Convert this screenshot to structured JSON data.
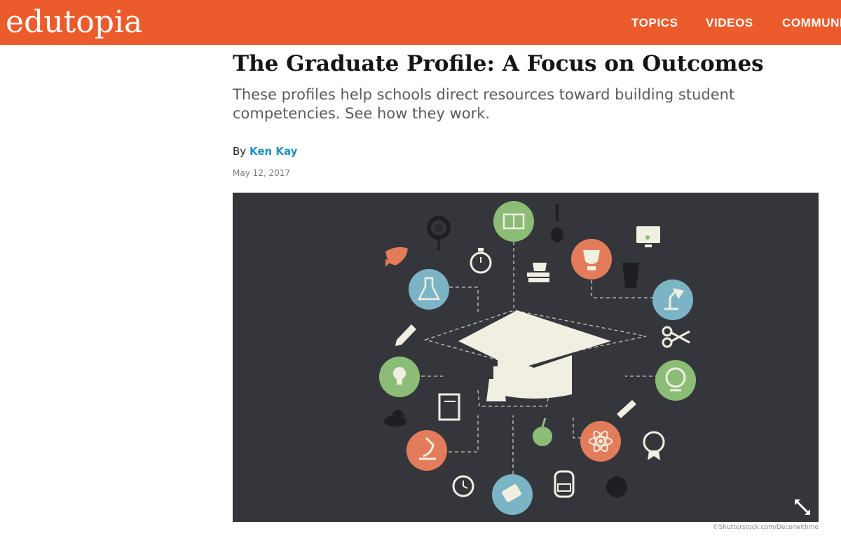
{
  "header": {
    "logo_text": "edutopia",
    "nav": [
      {
        "label": "TOPICS"
      },
      {
        "label": "VIDEOS"
      },
      {
        "label": "COMMUNI"
      }
    ],
    "brand_color": "#ec5b2b"
  },
  "article": {
    "title": "The Graduate Profile: A Focus on Outcomes",
    "subtitle": "These profiles help schools direct resources toward building student competencies. See how they work.",
    "byline_prefix": "By",
    "author": "Ken Kay",
    "date": "May 12, 2017"
  },
  "image": {
    "credit": "©Shutterstock.com/Decorwithme",
    "icons": [
      "book-icon",
      "trophy-icon",
      "lamp-icon",
      "globe-icon",
      "atom-icon",
      "paint-icon",
      "microscope-icon",
      "lightbulb-icon",
      "flask-icon",
      "graduation-cap-icon",
      "rocket-icon",
      "flower-icon",
      "stopwatch-icon",
      "guitar-icon",
      "music-screen-icon",
      "coffee-stack-icon",
      "cup-icon",
      "pencil-icon",
      "scissors-icon",
      "notebook-icon",
      "pen-icon",
      "apple-icon",
      "cloud-icon",
      "alarm-clock-icon",
      "backpack-icon",
      "basketball-icon",
      "medal-icon",
      "expand-icon"
    ],
    "colors": {
      "background": "#35363b",
      "green": "#8bbd77",
      "orange": "#e37c5a",
      "blue": "#7bb4c5",
      "cream": "#f1eee2"
    }
  }
}
